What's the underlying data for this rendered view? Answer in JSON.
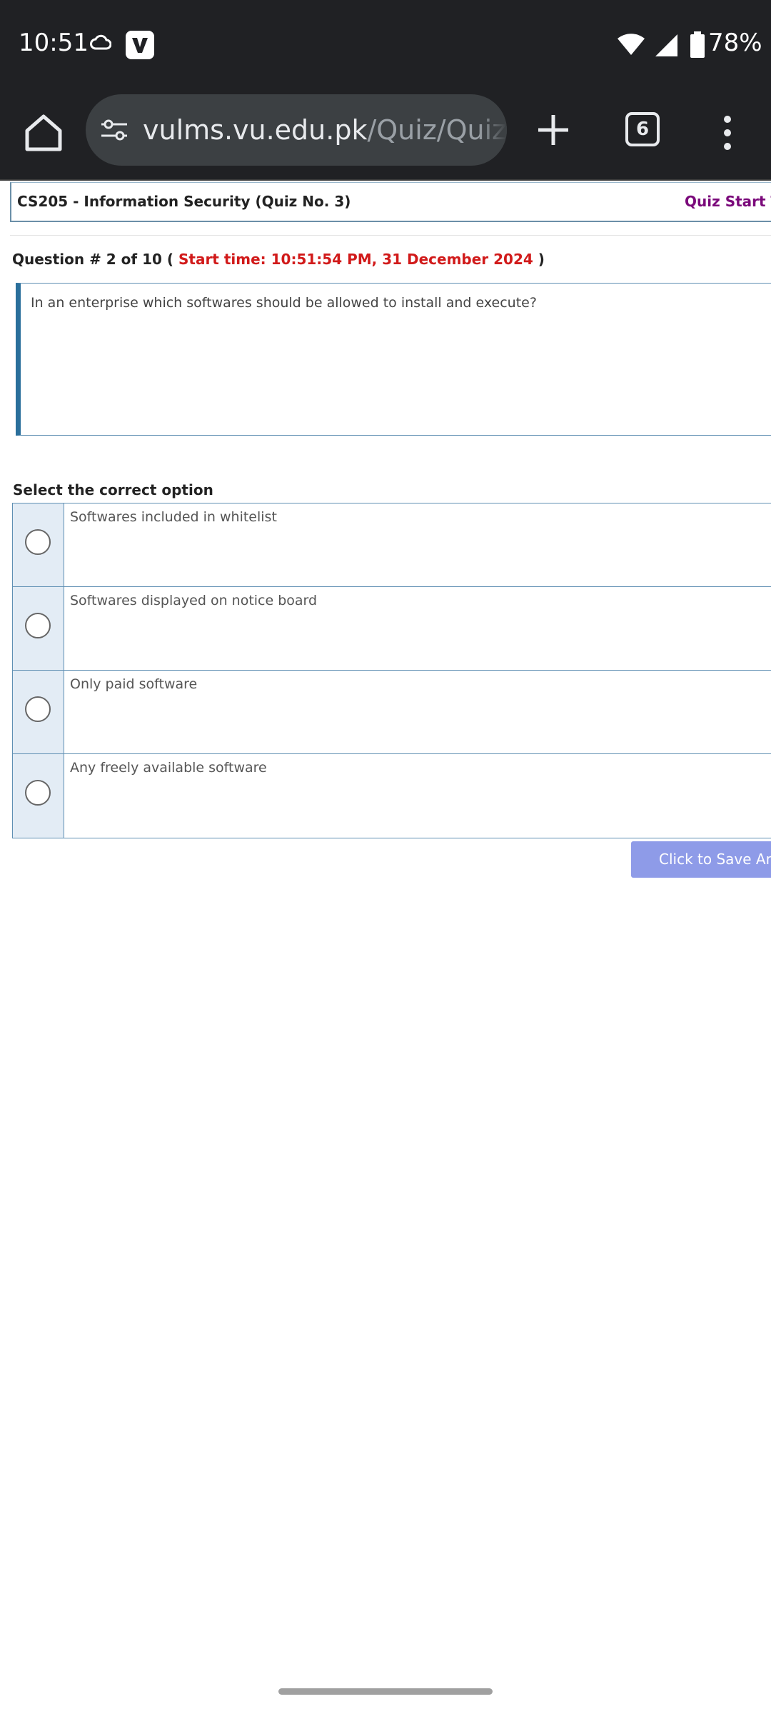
{
  "status_bar": {
    "time": "10:51",
    "battery": "78%"
  },
  "browser": {
    "url_domain": "vulms.vu.edu.pk",
    "url_path": "/Quiz/QuizQu",
    "tab_count": "6"
  },
  "quiz": {
    "title": "CS205 - Information Security (Quiz No. 3)",
    "start_label": "Quiz Start Tin",
    "question_prefix": "Question # 2 of 10 (",
    "start_time": "Start time: 10:51:54 PM, 31 December 2024",
    "question_suffix": ")",
    "question_text": "In an enterprise which softwares should be allowed to install and execute?",
    "select_label": "Select the correct option",
    "options": [
      {
        "label": "Softwares included in whitelist"
      },
      {
        "label": "Softwares displayed on notice board"
      },
      {
        "label": "Only paid software"
      },
      {
        "label": "Any freely available software"
      }
    ],
    "save_button": "Click to Save Ans"
  },
  "colors": {
    "chrome_bg": "#202124",
    "url_pill_bg": "#3c4043",
    "start_time_red": "#d11a1a",
    "quiz_start_purple": "#7b0a7b",
    "option_cell_bg": "#e3ecf5",
    "save_button_bg": "#8e9be8",
    "border_blue": "#5f8fb3"
  }
}
